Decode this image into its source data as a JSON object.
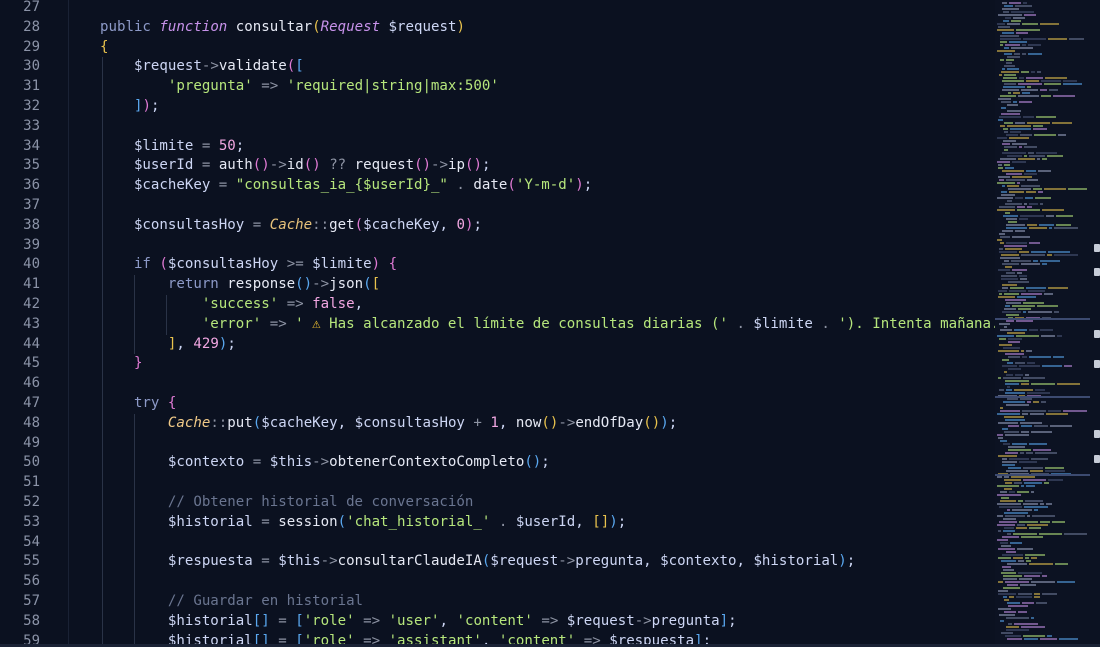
{
  "editor": {
    "language": "php",
    "first_line_number": 27,
    "line_numbers": [
      "27",
      "28",
      "29",
      "30",
      "31",
      "32",
      "33",
      "34",
      "35",
      "36",
      "37",
      "38",
      "39",
      "40",
      "41",
      "42",
      "43",
      "44",
      "45",
      "46",
      "47",
      "48",
      "49",
      "50",
      "51",
      "52",
      "53",
      "54",
      "55",
      "56",
      "57",
      "58",
      "59"
    ],
    "lines": [
      [],
      [
        [
          "kw",
          "public "
        ],
        [
          "kw-i",
          "function "
        ],
        [
          "fn",
          "consultar"
        ],
        [
          "br1",
          "("
        ],
        [
          "typ",
          "Request "
        ],
        [
          "var",
          "$request"
        ],
        [
          "br1",
          ")"
        ]
      ],
      [
        [
          "br1",
          "{"
        ]
      ],
      [
        [
          "var",
          "    $request"
        ],
        [
          "op",
          "->"
        ],
        [
          "fn",
          "validate"
        ],
        [
          "br2",
          "("
        ],
        [
          "br3",
          "["
        ]
      ],
      [
        [
          "str",
          "        'pregunta'"
        ],
        [
          "op",
          " => "
        ],
        [
          "str",
          "'required|string|max:500'"
        ]
      ],
      [
        [
          "br3",
          "    ]"
        ],
        [
          "br2",
          ")"
        ],
        [
          "var",
          ";"
        ]
      ],
      [],
      [
        [
          "var",
          "    $limite "
        ],
        [
          "op",
          "= "
        ],
        [
          "num",
          "50"
        ],
        [
          "var",
          ";"
        ]
      ],
      [
        [
          "var",
          "    $userId "
        ],
        [
          "op",
          "= "
        ],
        [
          "fn",
          "auth"
        ],
        [
          "br2",
          "()"
        ],
        [
          "op",
          "->"
        ],
        [
          "fn",
          "id"
        ],
        [
          "br2",
          "()"
        ],
        [
          "op",
          " ?? "
        ],
        [
          "fn",
          "request"
        ],
        [
          "br2",
          "()"
        ],
        [
          "op",
          "->"
        ],
        [
          "fn",
          "ip"
        ],
        [
          "br2",
          "()"
        ],
        [
          "var",
          ";"
        ]
      ],
      [
        [
          "var",
          "    $cacheKey "
        ],
        [
          "op",
          "= "
        ],
        [
          "str",
          "\"consultas_ia_{$userId}_\""
        ],
        [
          "op",
          " . "
        ],
        [
          "fn",
          "date"
        ],
        [
          "br2",
          "("
        ],
        [
          "str",
          "'Y-m-d'"
        ],
        [
          "br2",
          ")"
        ],
        [
          "var",
          ";"
        ]
      ],
      [],
      [
        [
          "var",
          "    $consultasHoy "
        ],
        [
          "op",
          "= "
        ],
        [
          "cls",
          "Cache"
        ],
        [
          "op",
          "::"
        ],
        [
          "fn",
          "get"
        ],
        [
          "br2",
          "("
        ],
        [
          "var",
          "$cacheKey, "
        ],
        [
          "num",
          "0"
        ],
        [
          "br2",
          ")"
        ],
        [
          "var",
          ";"
        ]
      ],
      [],
      [
        [
          "kw",
          "    if "
        ],
        [
          "br2",
          "("
        ],
        [
          "var",
          "$consultasHoy "
        ],
        [
          "op",
          ">= "
        ],
        [
          "var",
          "$limite"
        ],
        [
          "br2",
          ")"
        ],
        [
          "br2",
          " {"
        ]
      ],
      [
        [
          "kw",
          "        return "
        ],
        [
          "fn",
          "response"
        ],
        [
          "br3",
          "()"
        ],
        [
          "op",
          "->"
        ],
        [
          "fn",
          "json"
        ],
        [
          "br3",
          "("
        ],
        [
          "br1",
          "["
        ]
      ],
      [
        [
          "str",
          "            'success'"
        ],
        [
          "op",
          " => "
        ],
        [
          "num",
          "false"
        ],
        [
          "var",
          ","
        ]
      ],
      [
        [
          "str",
          "            'error'"
        ],
        [
          "op",
          " => "
        ],
        [
          "str",
          "' "
        ],
        [
          "warn",
          "⚠"
        ],
        [
          "str",
          " Has alcanzado el límite de consultas diarias ('"
        ],
        [
          "op",
          " . "
        ],
        [
          "var",
          "$limite"
        ],
        [
          "op",
          " . "
        ],
        [
          "str",
          "'). Intenta mañana.'"
        ]
      ],
      [
        [
          "br1",
          "        ]"
        ],
        [
          "var",
          ", "
        ],
        [
          "num",
          "429"
        ],
        [
          "br3",
          ")"
        ],
        [
          "var",
          ";"
        ]
      ],
      [
        [
          "br2",
          "    }"
        ]
      ],
      [],
      [
        [
          "kw",
          "    try "
        ],
        [
          "br2",
          "{"
        ]
      ],
      [
        [
          "cls2",
          "        Cache"
        ],
        [
          "op",
          "::"
        ],
        [
          "fn",
          "put"
        ],
        [
          "br3",
          "("
        ],
        [
          "var",
          "$cacheKey, $consultasHoy "
        ],
        [
          "op",
          "+ "
        ],
        [
          "num",
          "1"
        ],
        [
          "var",
          ", "
        ],
        [
          "fn",
          "now"
        ],
        [
          "br1",
          "()"
        ],
        [
          "op",
          "->"
        ],
        [
          "fn",
          "endOfDay"
        ],
        [
          "br1",
          "()"
        ],
        [
          "br3",
          ")"
        ],
        [
          "var",
          ";"
        ]
      ],
      [],
      [
        [
          "var",
          "        $contexto "
        ],
        [
          "op",
          "= "
        ],
        [
          "var",
          "$this"
        ],
        [
          "op",
          "->"
        ],
        [
          "fn",
          "obtenerContextoCompleto"
        ],
        [
          "br3",
          "()"
        ],
        [
          "var",
          ";"
        ]
      ],
      [],
      [
        [
          "cmt",
          "        // Obtener historial de conversación"
        ]
      ],
      [
        [
          "var",
          "        $historial "
        ],
        [
          "op",
          "= "
        ],
        [
          "fn",
          "session"
        ],
        [
          "br3",
          "("
        ],
        [
          "str",
          "'chat_historial_'"
        ],
        [
          "op",
          " . "
        ],
        [
          "var",
          "$userId, "
        ],
        [
          "br1",
          "[]"
        ],
        [
          "br3",
          ")"
        ],
        [
          "var",
          ";"
        ]
      ],
      [],
      [
        [
          "var",
          "        $respuesta "
        ],
        [
          "op",
          "= "
        ],
        [
          "var",
          "$this"
        ],
        [
          "op",
          "->"
        ],
        [
          "fn",
          "consultarClaudeIA"
        ],
        [
          "br3",
          "("
        ],
        [
          "var",
          "$request"
        ],
        [
          "op",
          "->"
        ],
        [
          "var",
          "pregunta, $contexto, $historial"
        ],
        [
          "br3",
          ")"
        ],
        [
          "var",
          ";"
        ]
      ],
      [],
      [
        [
          "cmt",
          "        // Guardar en historial"
        ]
      ],
      [
        [
          "var",
          "        $historial"
        ],
        [
          "br3",
          "[]"
        ],
        [
          "op",
          " = "
        ],
        [
          "br3",
          "["
        ],
        [
          "str",
          "'role'"
        ],
        [
          "op",
          " => "
        ],
        [
          "str",
          "'user'"
        ],
        [
          "var",
          ", "
        ],
        [
          "str",
          "'content'"
        ],
        [
          "op",
          " => "
        ],
        [
          "var",
          "$request"
        ],
        [
          "op",
          "->"
        ],
        [
          "var",
          "pregunta"
        ],
        [
          "br3",
          "]"
        ],
        [
          "var",
          ";"
        ]
      ],
      [
        [
          "var",
          "        $historial"
        ],
        [
          "br3",
          "[]"
        ],
        [
          "op",
          " = "
        ],
        [
          "br3",
          "["
        ],
        [
          "str",
          "'role'"
        ],
        [
          "op",
          " => "
        ],
        [
          "str",
          "'assistant'"
        ],
        [
          "var",
          ", "
        ],
        [
          "str",
          "'content'"
        ],
        [
          "op",
          " => "
        ],
        [
          "var",
          "$respuesta"
        ],
        [
          "br3",
          "]"
        ],
        [
          "var",
          ";"
        ]
      ]
    ]
  },
  "colors": {
    "background": "#0b1120",
    "string": "#b6e67c",
    "number": "#f2a7e2",
    "keyword": "#8d9ac8",
    "comment": "#6a7590",
    "bracket_gold": "#e8c24d",
    "bracket_pink": "#e07ad4",
    "bracket_blue": "#5aa8f0"
  },
  "minimap": {
    "visible": true
  }
}
